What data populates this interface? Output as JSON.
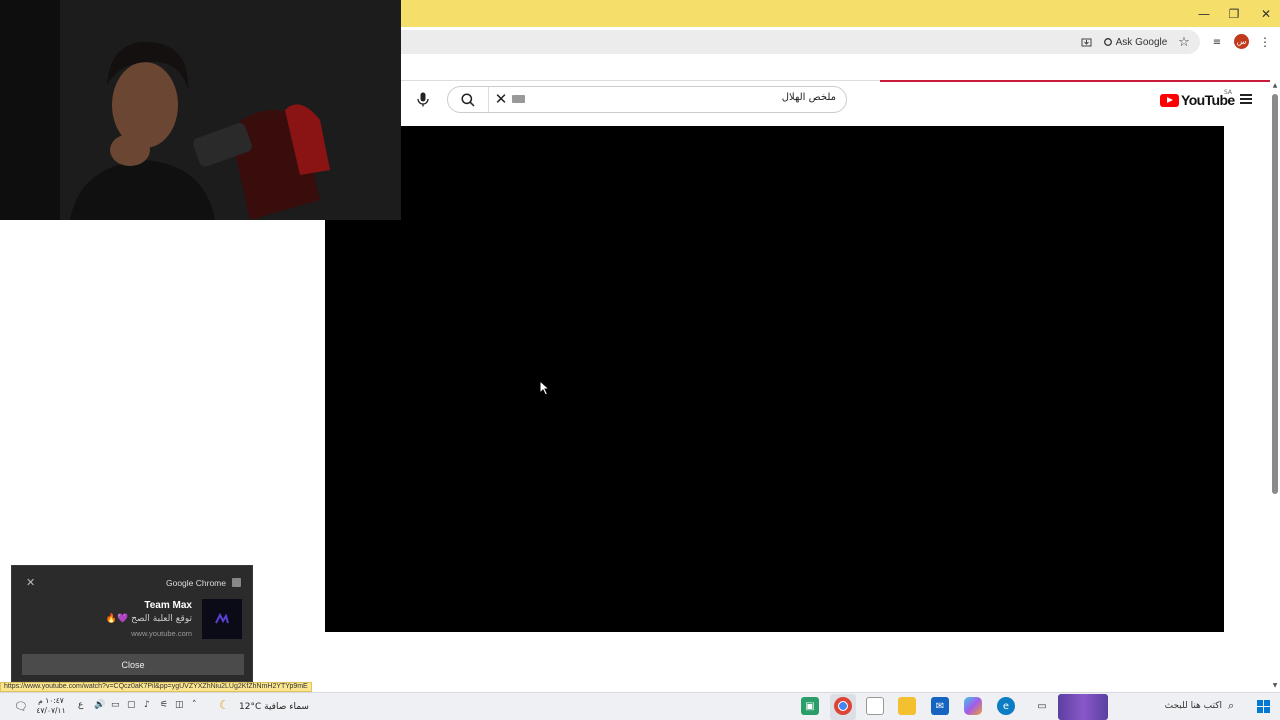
{
  "browser": {
    "ask_google_label": "Ask Google",
    "avatar_initial": "س",
    "status_url": "https://www.youtube.com/watch?v=CQcz0aK7Pil&pp=ygUVZYXZhNiu2LUg2KfZhNmH2YTYp9mE",
    "window": {
      "minimize": "—",
      "restore": "❐",
      "close": "✕"
    }
  },
  "youtube": {
    "logo_text": "YouTube",
    "region_badge": "SA",
    "search_query": "ملخص الهلال"
  },
  "notification": {
    "app_name": "Google Chrome",
    "title": "Team Max",
    "message": "توقع العلبة الصح 💜🔥",
    "source": "www.youtube.com",
    "close_button": "Close"
  },
  "taskbar": {
    "search_placeholder": "اكتب هنا للبحث",
    "weather_temp": "12°C",
    "weather_text": "سماء صافية",
    "clock_time": "١٠:٤٧ م",
    "clock_date": "٤٧/٠٧/١١",
    "lang_indicator": "ع"
  },
  "colors": {
    "titlebar": "#f5df6a",
    "yt_red": "#ff0000",
    "video_bg": "#000000"
  }
}
